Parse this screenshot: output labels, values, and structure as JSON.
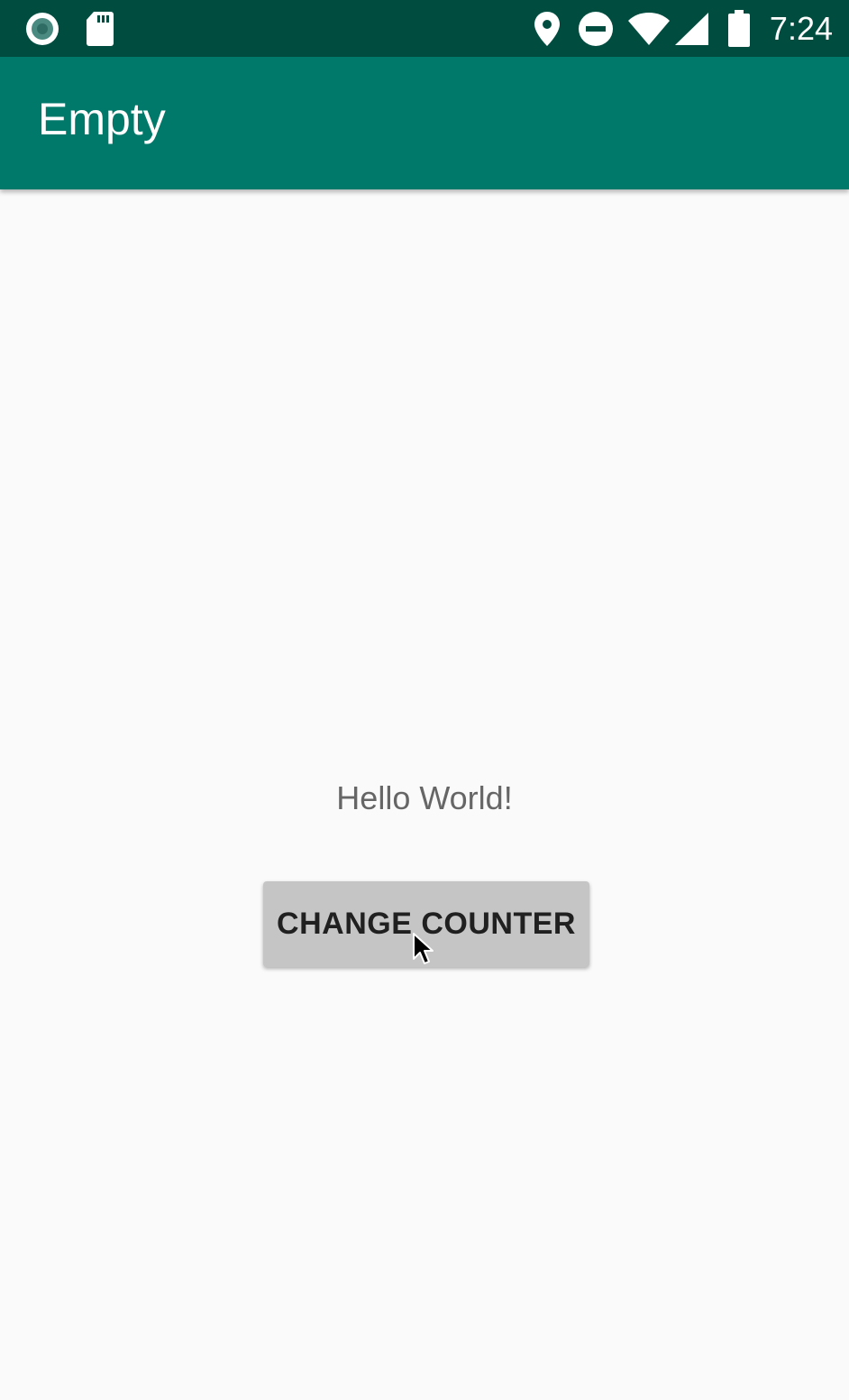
{
  "status_bar": {
    "time": "7:24",
    "icons": [
      "record-icon",
      "sd-card-icon",
      "location-icon",
      "do-not-disturb-icon",
      "wifi-icon",
      "cellular-signal-icon",
      "battery-icon"
    ],
    "background": "#004d40"
  },
  "app_bar": {
    "title": "Empty",
    "background": "#00796b"
  },
  "main": {
    "hello_text": "Hello World!",
    "button_label": "CHANGE COUNTER"
  },
  "colors": {
    "page_background": "#fafafa",
    "button_background": "#c4c5c4"
  }
}
